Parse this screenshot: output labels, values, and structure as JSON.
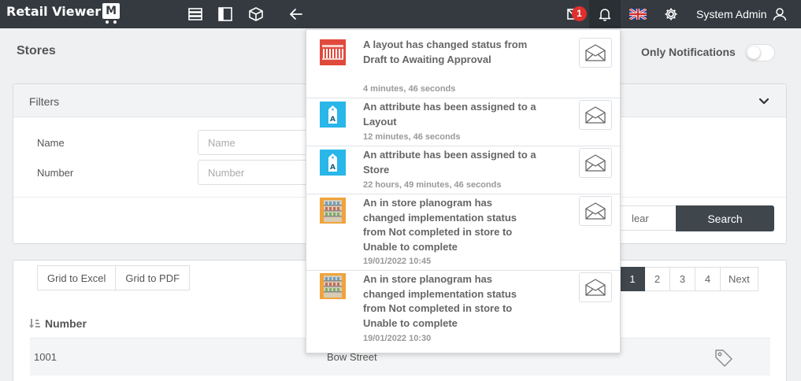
{
  "app": {
    "logo_text": "Retail Viewer",
    "logo_mark": "M"
  },
  "topbar": {
    "icons": [
      "list-icon",
      "columns-icon",
      "box-icon",
      "arrow-left-icon"
    ],
    "mail_badge": "1",
    "user": "System Admin"
  },
  "page": {
    "title": "Stores",
    "only_notifications_label": "Only Notifications",
    "only_notifications_on": false
  },
  "filters": {
    "title": "Filters",
    "fields": [
      {
        "label": "Name",
        "placeholder": "Name"
      },
      {
        "label": "Number",
        "placeholder": "Number"
      }
    ],
    "clear_label": "lear",
    "search_label": "Search"
  },
  "grid": {
    "export_buttons": [
      "Grid to Excel",
      "Grid to PDF"
    ],
    "pager": [
      "1",
      "2",
      "3",
      "4",
      "Next"
    ],
    "active_page": "1",
    "column_number": "Number",
    "rows": [
      {
        "number": "1001",
        "name": "Bow Street"
      }
    ]
  },
  "notifications": [
    {
      "icon": "layout-store-icon",
      "text": "A layout has changed status from Draft to Awaiting Approval",
      "time": "4 minutes, 46 seconds"
    },
    {
      "icon": "attribute-tag-icon",
      "text": "An attribute has been assigned to a Layout",
      "time": "12 minutes, 46 seconds"
    },
    {
      "icon": "attribute-tag-icon",
      "text": "An attribute has been assigned to a Store",
      "time": "22 hours, 49 minutes, 46 seconds"
    },
    {
      "icon": "planogram-shelf-icon",
      "text": "An in store planogram has changed implementation status from Not completed in store to Unable to complete",
      "time": "19/01/2022 10:45"
    },
    {
      "icon": "planogram-shelf-icon",
      "text": "An in store planogram has changed implementation status from Not completed in store to Unable to complete",
      "time": "19/01/2022 10:30"
    }
  ],
  "colors": {
    "topbar": "#343a40",
    "badge": "#e0302e",
    "search_button": "#3f464c",
    "attribute_icon": "#29b6e8",
    "layout_icon": "#e04a3c",
    "planogram_icon": "#f0a33c"
  }
}
